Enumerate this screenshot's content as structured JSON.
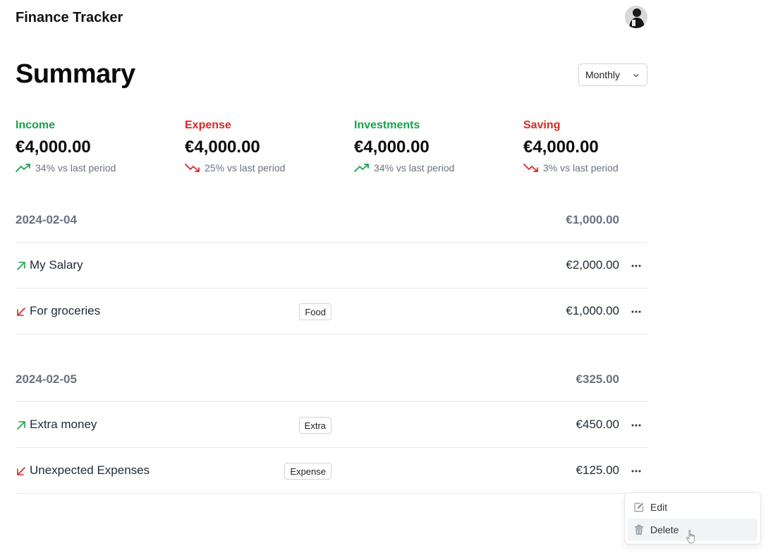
{
  "app": {
    "title": "Finance Tracker"
  },
  "summary": {
    "title": "Summary",
    "period": "Monthly"
  },
  "stats": [
    {
      "label": "Income",
      "amount": "€4,000.00",
      "trend": "34% vs last period",
      "direction": "up",
      "color": "#16a34a"
    },
    {
      "label": "Expense",
      "amount": "€4,000.00",
      "trend": "25% vs last period",
      "direction": "down",
      "color": "#dc2626"
    },
    {
      "label": "Investments",
      "amount": "€4,000.00",
      "trend": "34% vs last period",
      "direction": "up",
      "color": "#16a34a"
    },
    {
      "label": "Saving",
      "amount": "€4,000.00",
      "trend": "3% vs last period",
      "direction": "down",
      "color": "#dc2626"
    }
  ],
  "groups": [
    {
      "date": "2024-02-04",
      "total": "€1,000.00",
      "transactions": [
        {
          "type": "income",
          "description": "My Salary",
          "category": "",
          "amount": "€2,000.00"
        },
        {
          "type": "expense",
          "description": "For groceries",
          "category": "Food",
          "amount": "€1,000.00"
        }
      ]
    },
    {
      "date": "2024-02-05",
      "total": "€325.00",
      "transactions": [
        {
          "type": "income",
          "description": "Extra money",
          "category": "Extra",
          "amount": "€450.00"
        },
        {
          "type": "expense",
          "description": "Unexpected Expenses",
          "category": "Expense",
          "amount": "€125.00"
        }
      ]
    }
  ],
  "context_menu": {
    "items": [
      {
        "label": "Edit",
        "icon": "edit-icon"
      },
      {
        "label": "Delete",
        "icon": "trash-icon"
      }
    ]
  }
}
